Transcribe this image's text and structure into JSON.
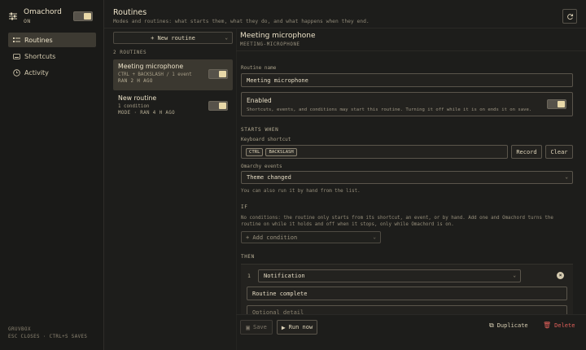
{
  "app": {
    "name": "Omachord",
    "state": "ON"
  },
  "sidebar": {
    "items": [
      {
        "label": "Routines",
        "icon": "routines-icon"
      },
      {
        "label": "Shortcuts",
        "icon": "keyboard-icon"
      },
      {
        "label": "Activity",
        "icon": "clock-icon"
      }
    ],
    "footer_theme": "GRUVBOX",
    "footer_hint": "ESC CLOSES · CTRL+S SAVES"
  },
  "header": {
    "title": "Routines",
    "subtitle": "Modes and routines: what starts them, what they do, and what happens when they end."
  },
  "list": {
    "new_button": "+ New routine",
    "count_label": "2 ROUTINES",
    "routines": [
      {
        "name": "Meeting microphone",
        "meta": "CTRL + BACKSLASH / 1 event",
        "ran": "RAN 2 H AGO",
        "enabled": true
      },
      {
        "name": "New routine",
        "meta": "1 condition",
        "ran": "MODE · RAN 4 H AGO",
        "enabled": true
      }
    ]
  },
  "detail": {
    "title": "Meeting microphone",
    "slug": "MEETING-MICROPHONE",
    "name_label": "Routine name",
    "name_value": "Meeting microphone",
    "enabled_title": "Enabled",
    "enabled_desc": "Shortcuts, events, and conditions may start this routine. Turning it off while it is on ends it on save.",
    "starts_when": "STARTS WHEN",
    "shortcut_label": "Keyboard shortcut",
    "shortcut_keys": [
      "CTRL",
      "BACKSLASH"
    ],
    "record_label": "Record",
    "clear_label": "Clear",
    "events_label": "Omarchy events",
    "event_value": "Theme changed",
    "manual_hint": "You can also run it by hand from the list.",
    "if_label": "IF",
    "if_hint": "No conditions: the routine only starts from its shortcut, an event, or by hand. Add one and Omachord turns the routine on while it holds and off when it stops, only while Omachord is on.",
    "add_condition": "+ Add condition",
    "then_label": "THEN",
    "action_index": "1",
    "action_type": "Notification",
    "notification_title": "Routine complete",
    "notification_body_placeholder": "Optional detail"
  },
  "footer": {
    "save_label": "Save",
    "run_label": "Run now",
    "duplicate_label": "Duplicate",
    "delete_label": "Delete"
  },
  "colors": {
    "background": "#1d1d1b",
    "accent": "#e8d8a8",
    "danger": "#e0605a",
    "text": "#e6dcc4"
  }
}
